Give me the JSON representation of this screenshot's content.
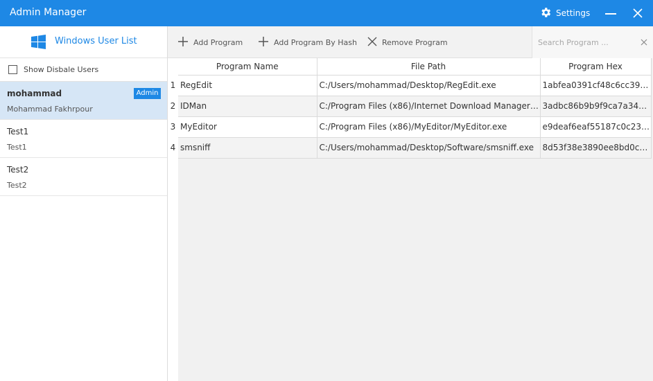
{
  "window": {
    "title": "Admin Manager",
    "settings_label": "Settings"
  },
  "sidebar": {
    "header": "Windows User List",
    "show_disabled_label": "Show Disbale Users",
    "users": [
      {
        "username": "mohammad",
        "fullname": "Mohammad Fakhrpour",
        "badge": "Admin",
        "selected": true
      },
      {
        "username": "Test1",
        "fullname": "Test1"
      },
      {
        "username": "Test2",
        "fullname": "Test2"
      }
    ]
  },
  "toolbar": {
    "add_program": "Add Program",
    "add_by_hash": "Add Program By Hash",
    "remove_program": "Remove Program",
    "search_placeholder": "Search Program ..."
  },
  "grid": {
    "columns": [
      "Program Name",
      "File Path",
      "Program Hex"
    ],
    "rows": [
      {
        "num": "1",
        "name": "RegEdit",
        "path": "C:/Users/mohammad/Desktop/RegEdit.exe",
        "hex": "1abfea0391cf48c6cc393f..."
      },
      {
        "num": "2",
        "name": "IDMan",
        "path": "C:/Program Files (x86)/Internet Download Manager/ID...",
        "hex": "3adbc86b9b9f9ca7a3421..."
      },
      {
        "num": "3",
        "name": "MyEditor",
        "path": "C:/Program Files (x86)/MyEditor/MyEditor.exe",
        "hex": "e9deaf6eaf55187c0c23c..."
      },
      {
        "num": "4",
        "name": "smsniff",
        "path": "C:/Users/mohammad/Desktop/Software/smsniff.exe",
        "hex": "8d53f38e3890ee8bd0ca9..."
      }
    ]
  },
  "colors": {
    "accent": "#1e88e5",
    "selected_row": "#d6e6f6",
    "toolbar_bg": "#f2f2f2"
  },
  "icons": {
    "settings": "gear-icon",
    "minimize": "minimize-icon",
    "close": "close-icon",
    "brand": "windows-logo-icon",
    "add": "plus-icon",
    "remove": "x-icon",
    "search_clear": "clear-icon"
  }
}
